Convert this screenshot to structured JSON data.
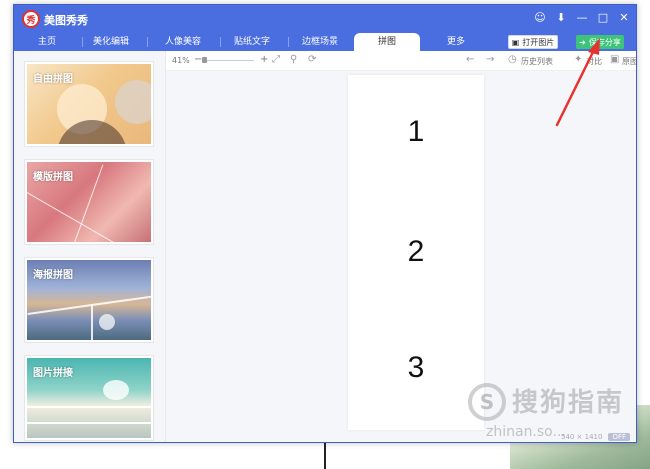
{
  "window": {
    "app_title": "美图秀秀",
    "logo_glyph": "秀",
    "accent": "#4a6ee0",
    "controls": [
      "☺",
      "⬇",
      "—",
      "□",
      "✕"
    ]
  },
  "tabs": [
    {
      "label": "主页"
    },
    {
      "label": "美化编辑"
    },
    {
      "label": "人像美容"
    },
    {
      "label": "贴纸文字"
    },
    {
      "label": "边框场景"
    },
    {
      "label": "拼图",
      "active": true
    },
    {
      "label": "更多"
    }
  ],
  "header_buttons": {
    "open_label": "打开图片",
    "save_label": "保存分享",
    "save_color": "#3ec47a"
  },
  "sidebar": {
    "cards": [
      {
        "label": "自由拼图"
      },
      {
        "label": "模版拼图"
      },
      {
        "label": "海报拼图"
      },
      {
        "label": "图片拼接"
      }
    ]
  },
  "toolbar": {
    "zoom": "41%",
    "minus": "−",
    "plus": "+",
    "history_label": "历史列表",
    "compare_label": "对比",
    "original_label": "原图"
  },
  "canvas": {
    "numbers": [
      "1",
      "2",
      "3"
    ]
  },
  "status": {
    "size": "540 × 1410",
    "badge": "OFF"
  },
  "watermark": {
    "logo": "S",
    "text": "搜狗指南",
    "sub": "zhinan.so..."
  }
}
